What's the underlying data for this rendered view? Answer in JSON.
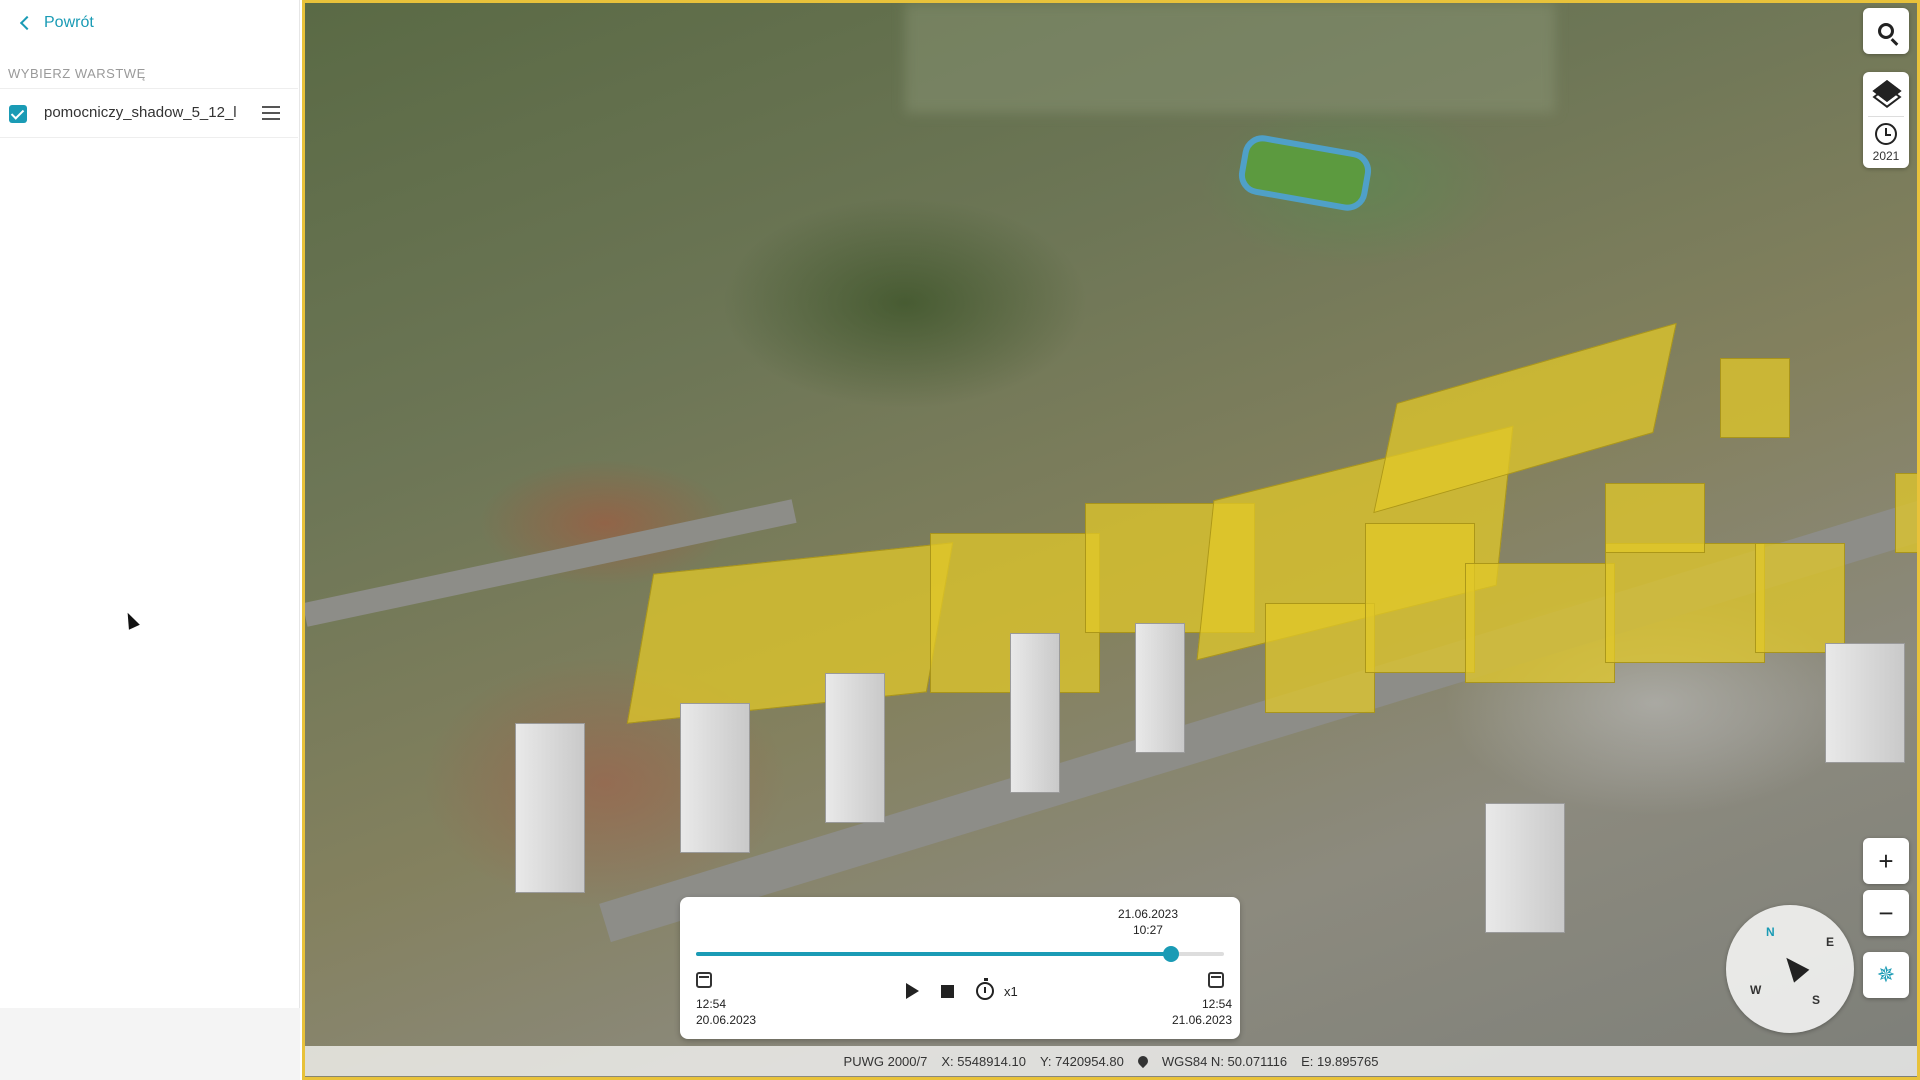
{
  "sidebar": {
    "back_label": "Powrót",
    "section_label": "WYBIERZ WARSTWĘ",
    "layers": [
      {
        "name": "pomocniczy_shadow_5_12_l",
        "checked": true
      }
    ]
  },
  "map": {
    "layer_year": "2021",
    "compass": {
      "n": "N",
      "e": "E",
      "s": "S",
      "w": "W"
    },
    "zoom_in": "+",
    "zoom_out": "−"
  },
  "timeline": {
    "current_date": "21.06.2023",
    "current_time": "10:27",
    "progress": 0.9,
    "start_time": "12:54",
    "start_date": "20.06.2023",
    "end_time": "12:54",
    "end_date": "21.06.2023",
    "speed": "x1"
  },
  "status": {
    "crs": "PUWG 2000/7",
    "x": "X: 5548914.10",
    "y": "Y: 7420954.80",
    "wgs_n": "WGS84 N: 50.071116",
    "wgs_e": "E: 19.895765"
  },
  "colors": {
    "accent": "#1a9bb5",
    "highlight_building": "#e1c828",
    "map_border": "#e8c23a"
  }
}
